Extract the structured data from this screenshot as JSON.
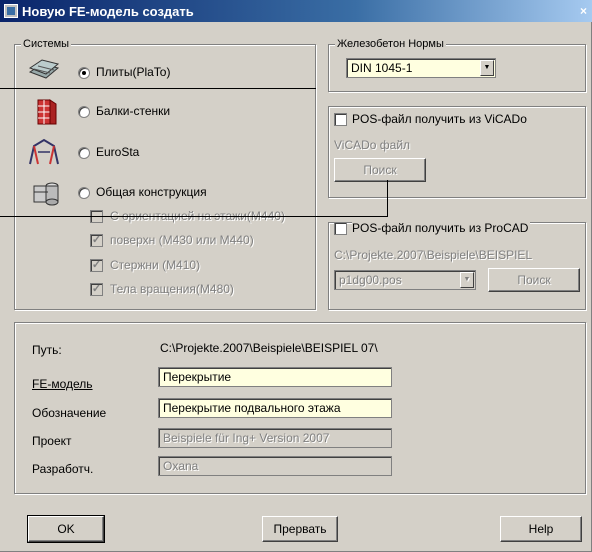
{
  "window": {
    "title": "Новую FE-модель создать"
  },
  "systems": {
    "legend": "Системы",
    "options": [
      {
        "label": "Плиты(PlaTo)",
        "checked": true,
        "icon": "slab-icon"
      },
      {
        "label": "Балки-стенки",
        "checked": false,
        "icon": "wall-beam-icon"
      },
      {
        "label": "EuroSta",
        "checked": false,
        "icon": "frame-icon"
      },
      {
        "label": "Общая конструкция",
        "checked": false,
        "icon": "general-structure-icon"
      }
    ],
    "suboptions": [
      {
        "label": "С ориентацией на этажи(M440)",
        "checked": false
      },
      {
        "label": "поверхн (M430 или M440)",
        "checked": true
      },
      {
        "label": "Стержни (M410)",
        "checked": true
      },
      {
        "label": "Тела вращения(M480)",
        "checked": true
      }
    ]
  },
  "norms": {
    "legend": "Железобетон Нормы",
    "value": "DIN 1045-1"
  },
  "vicado": {
    "checkbox_label": "POS-файл получить из ViCADo",
    "file_label": "ViCADo файл",
    "search_label": "Поиск"
  },
  "procad": {
    "checkbox_label": "POS-файл получить из ProCAD",
    "path": "C:\\Projekte.2007\\Beispiele\\BEISPIEL",
    "file_value": "p1dg00.pos",
    "search_label": "Поиск"
  },
  "details": {
    "path_label": "Путь:",
    "path_value": "C:\\Projekte.2007\\Beispiele\\BEISPIEL 07\\",
    "fe_model_label": "FE-модель",
    "fe_model_value": "Перекрытие",
    "designation_label": "Обозначение",
    "designation_value": "Перекрытие подвального этажа",
    "project_label": "Проект",
    "project_value": "Beispiele für Ing+ Version 2007",
    "developer_label": "Разработч.",
    "developer_value": "Oxana"
  },
  "buttons": {
    "ok": "OK",
    "cancel": "Прервать",
    "help": "Help"
  }
}
